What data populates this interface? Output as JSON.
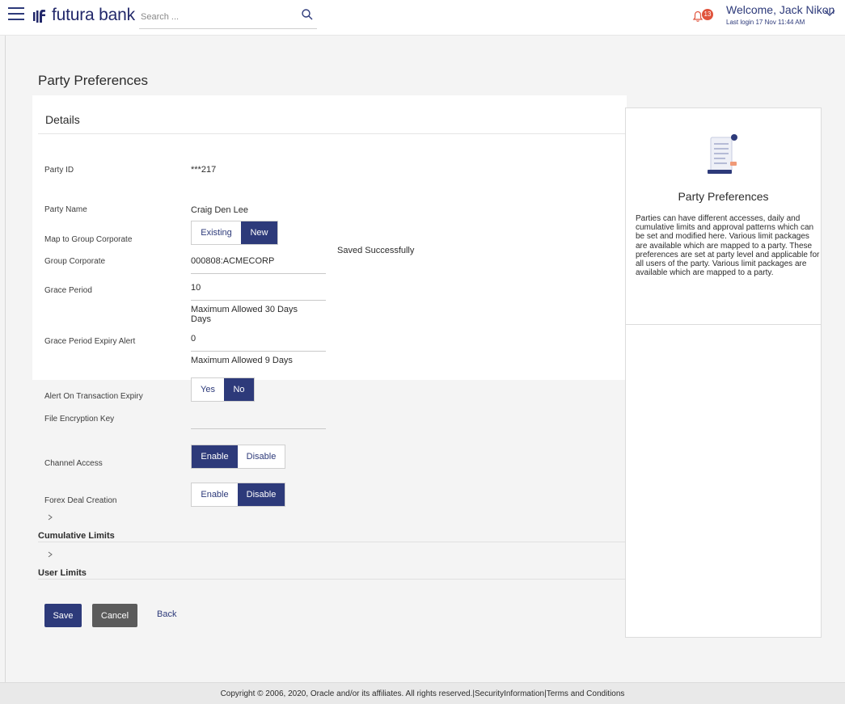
{
  "header": {
    "brand": "futura bank",
    "search_placeholder": "Search ...",
    "notification_count": "13",
    "welcome": "Welcome, Jack Nikon",
    "last_login": "Last login 17 Nov 11:44 AM"
  },
  "page": {
    "title": "Party Preferences"
  },
  "details": {
    "title": "Details",
    "fields": {
      "party_id": {
        "label": "Party ID",
        "value": "***217"
      },
      "party_name": {
        "label": "Party Name",
        "value": "Craig Den Lee"
      },
      "map_group": {
        "label": "Map to Group Corporate",
        "options": [
          "Existing",
          "New"
        ],
        "selected": "New"
      },
      "group_corporate": {
        "label": "Group Corporate",
        "value": "000808:ACMECORP"
      },
      "grace_period": {
        "label": "Grace Period",
        "value": "10",
        "hint": "Maximum Allowed 30 Days Days"
      },
      "grace_expiry_alert": {
        "label": "Grace Period Expiry Alert",
        "value": "0",
        "hint": "Maximum Allowed 9 Days"
      },
      "alert_txn_expiry": {
        "label": "Alert On Transaction Expiry",
        "options": [
          "Yes",
          "No"
        ],
        "selected": "No"
      },
      "file_encryption_key": {
        "label": "File Encryption Key",
        "value": ""
      },
      "channel_access": {
        "label": "Channel Access",
        "options": [
          "Enable",
          "Disable"
        ],
        "selected": "Enable"
      },
      "forex_deal": {
        "label": "Forex Deal Creation",
        "options": [
          "Enable",
          "Disable"
        ],
        "selected": "Disable"
      }
    },
    "saved_message": "Saved Successfully"
  },
  "sections": {
    "cumulative_limits": "Cumulative Limits",
    "user_limits": "User Limits"
  },
  "actions": {
    "save": "Save",
    "cancel": "Cancel",
    "back": "Back"
  },
  "aside": {
    "title": "Party Preferences",
    "text": "Parties can have different accesses, daily and cumulative limits and approval patterns which can be set and modified here. Various limit packages are available which are mapped to a party. These preferences are set at party level and applicable for all users of the party. Various limit packages are available which are mapped to a party."
  },
  "footer": {
    "text": "Copyright © 2006, 2020, Oracle and/or its affiliates. All rights reserved.|SecurityInformation|Terms and Conditions"
  },
  "colors": {
    "primary": "#2d3a7a",
    "badge": "#e0533c",
    "cancel": "#5b5b5b"
  }
}
